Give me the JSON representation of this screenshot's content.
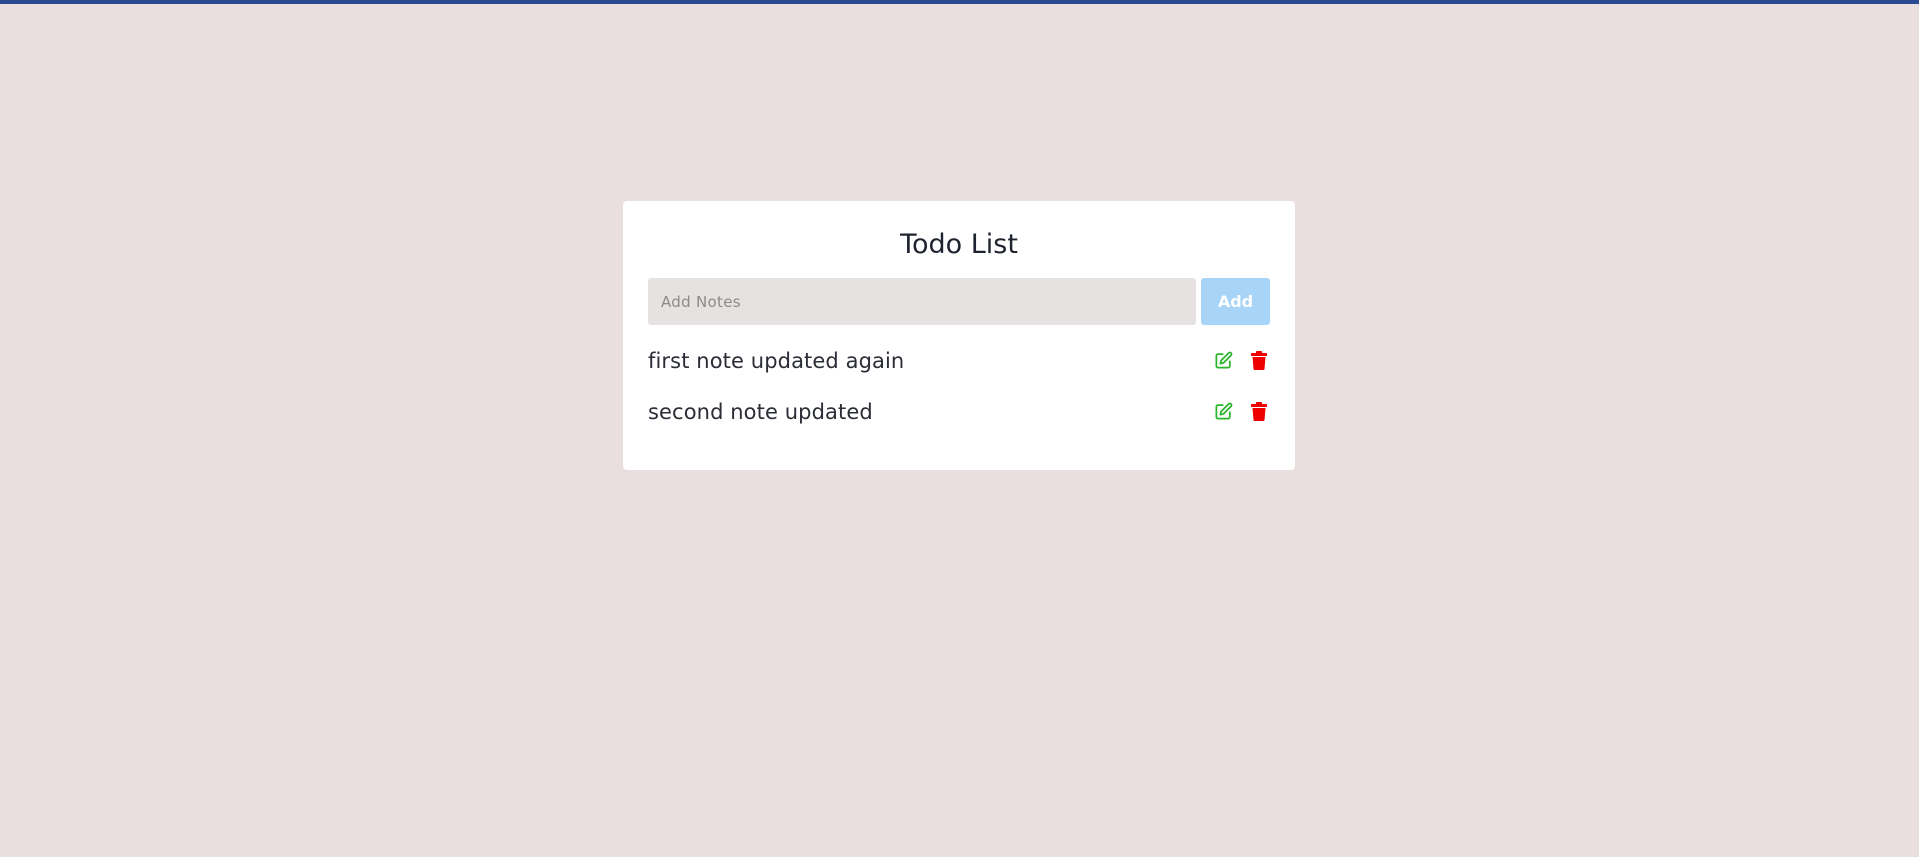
{
  "app": {
    "title": "Todo List"
  },
  "input": {
    "placeholder": "Add Notes",
    "value": ""
  },
  "add_button": {
    "label": "Add"
  },
  "todos": [
    {
      "text": "first note updated again",
      "edit_icon": "edit-icon",
      "delete_icon": "trash-icon"
    },
    {
      "text": "second note updated",
      "edit_icon": "edit-icon",
      "delete_icon": "trash-icon"
    }
  ],
  "colors": {
    "background": "#e8dfde",
    "top_bar": "#2a4a94",
    "card": "#ffffff",
    "input_bg": "#e6e2e1",
    "add_button": "#a8d5f7",
    "edit_icon": "#2bb52b",
    "delete_icon": "#ee0000"
  }
}
